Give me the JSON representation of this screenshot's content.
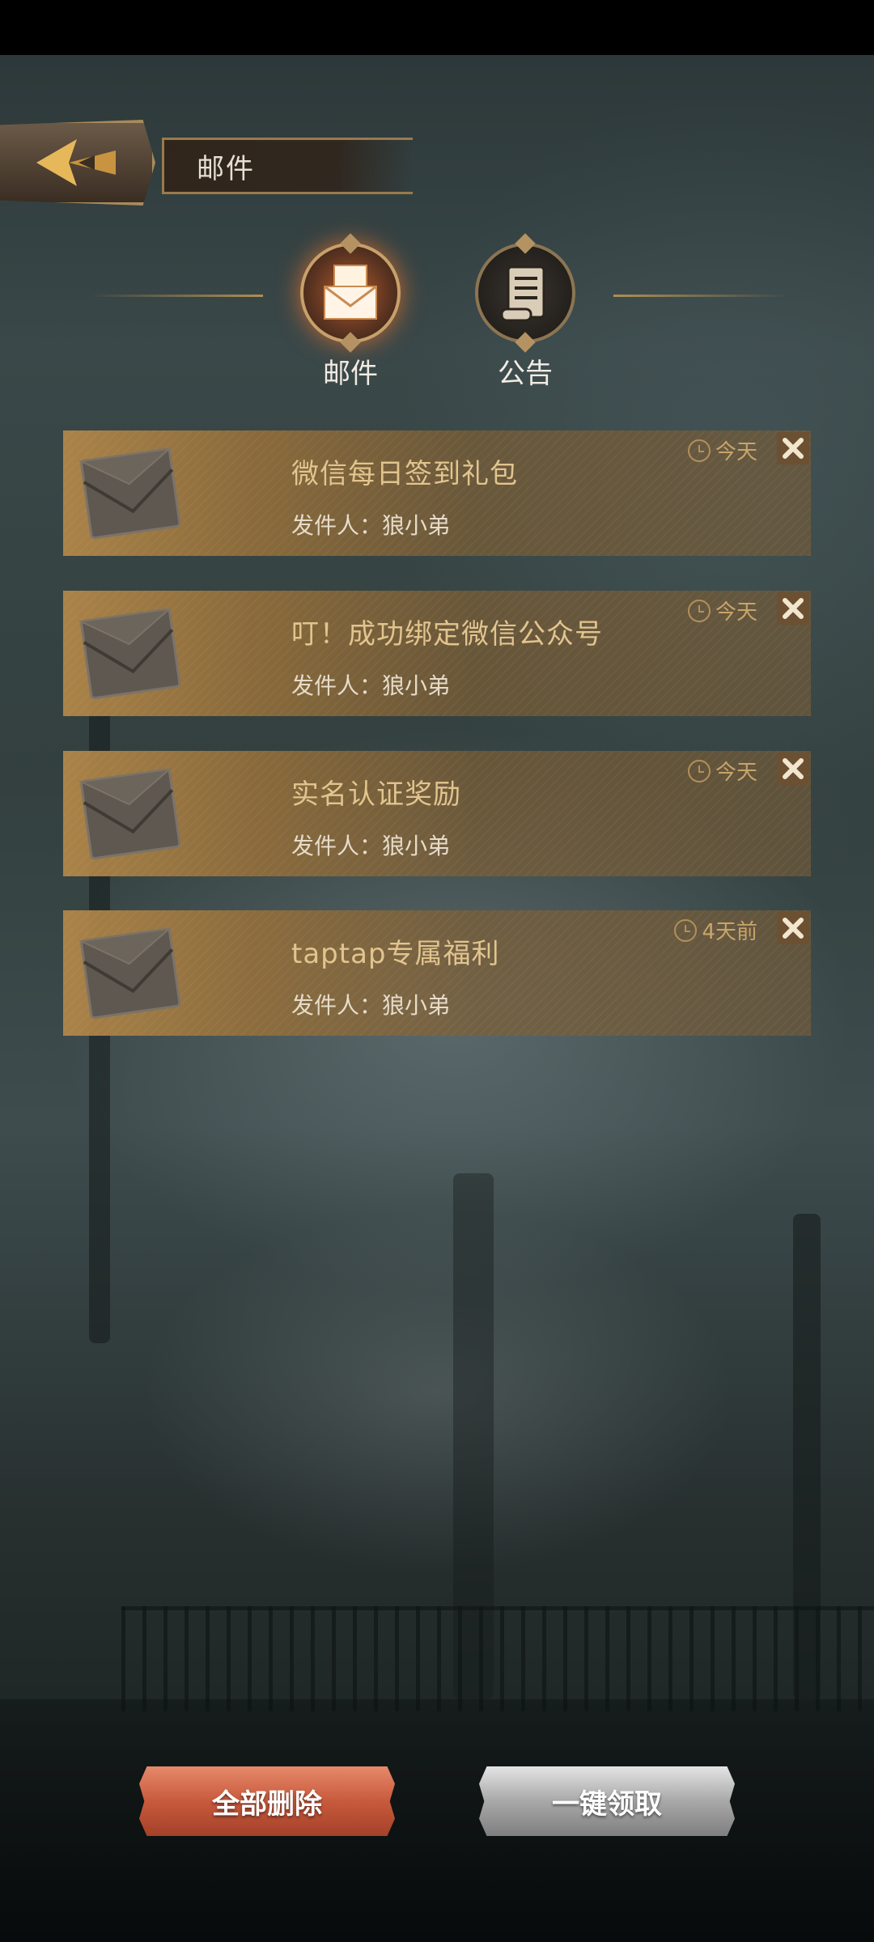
{
  "header": {
    "title": "邮件"
  },
  "tabs": [
    {
      "label": "邮件",
      "icon": "mail-icon",
      "active": true
    },
    {
      "label": "公告",
      "icon": "scroll-icon",
      "active": false
    }
  ],
  "mails": [
    {
      "title": "微信每日签到礼包",
      "sender": "发件人：狼小弟",
      "time": "今天"
    },
    {
      "title": "叮！成功绑定微信公众号",
      "sender": "发件人：狼小弟",
      "time": "今天"
    },
    {
      "title": "实名认证奖励",
      "sender": "发件人：狼小弟",
      "time": "今天"
    },
    {
      "title": "taptap专属福利",
      "sender": "发件人：狼小弟",
      "time": "4天前"
    }
  ],
  "buttons": {
    "delete_all": "全部删除",
    "claim_all": "一键领取"
  },
  "colors": {
    "accent_gold": "#b08e52",
    "delete_all_bg": "#c85a3c",
    "claim_all_bg": "#a8a8a8"
  }
}
